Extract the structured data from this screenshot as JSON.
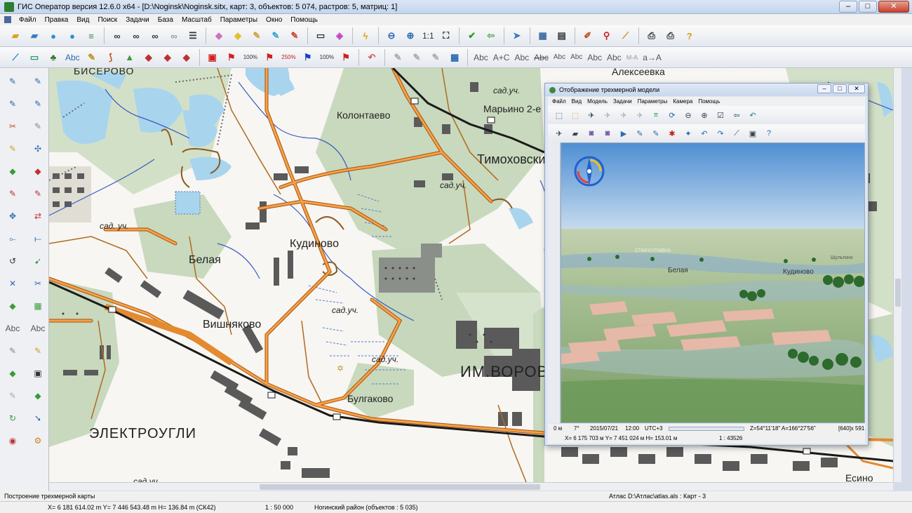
{
  "window": {
    "title": "ГИС Оператор версия 12.6.0 x64 - [D:\\Noginsk\\Noginsk.sitx, карт: 3, объектов: 5 074, растров: 5, матриц: 1]",
    "controls": [
      "–",
      "□",
      "✕"
    ]
  },
  "menu": {
    "items": [
      "Файл",
      "Правка",
      "Вид",
      "Поиск",
      "Задачи",
      "База",
      "Масштаб",
      "Параметры",
      "Окно",
      "Помощь"
    ]
  },
  "toolbar1": {
    "scale_label": "1:1"
  },
  "toolbar2": {
    "pct_a": "100%",
    "pct_b": "250%",
    "pct_c": "100%",
    "abc_labels": [
      "Abc",
      "A+C",
      "Abc",
      "Abc",
      "Abc",
      "Abc",
      "Abc",
      "Abc",
      "М-А",
      "а→А"
    ]
  },
  "left_toolbar": {
    "abc_labels": [
      "Abc",
      "Abc"
    ]
  },
  "map": {
    "labels": [
      "БИСЕРОВО",
      "Алексеевка",
      "Колонтаево",
      "Марьино 2-е",
      "сад.уч.",
      "Тимоховски",
      "сад.уч.",
      "сад. уч.",
      "Кудиново",
      "Белая",
      "сад.уч.",
      "Вишняково",
      "сад.уч.",
      "ИМ.ВОРОВ",
      "Булгаково",
      "ЭЛЕКТРОУГЛИ",
      "Есино",
      "сад.уч."
    ]
  },
  "window3d": {
    "title": "Отображение трехмерной модели",
    "menu": [
      "Файл",
      "Вид",
      "Модель",
      "Задачи",
      "Параметры",
      "Камера",
      "Помощь"
    ],
    "view_labels": [
      "СТАР.КУПАВНА",
      "Белая",
      "Кудиново",
      "Шульгино"
    ],
    "status1": {
      "height": "0 м",
      "angle": "7°",
      "date": "2015/07/21",
      "time": "12:00",
      "tz": "UTC+3",
      "latlon": "Z=54°11'18\"   A=166°27'56\"",
      "size": "[640]x 591"
    },
    "status2": {
      "coords": "X= 6 175 703 м   Y= 7 451 024 м   H= 153.01 м",
      "scale": "1 : 43526"
    }
  },
  "status": {
    "task": "Построение трехмерной карты",
    "atlas": "Атлас D:\\Атлас\\atlas.als : Карт - 3",
    "coords": "X= 6 181 614.02 m   Y= 7 446 543.48 m   H= 136.84 m   (СК42)",
    "scale": "1 : 50 000",
    "region": "Ногинский район  (объектов : 5 035)"
  },
  "colors": {
    "water": "#a8d4ee",
    "forest": "#c8d9be",
    "road": "#e48a30",
    "rail": "#1a1a1a",
    "urban": "#707070"
  }
}
